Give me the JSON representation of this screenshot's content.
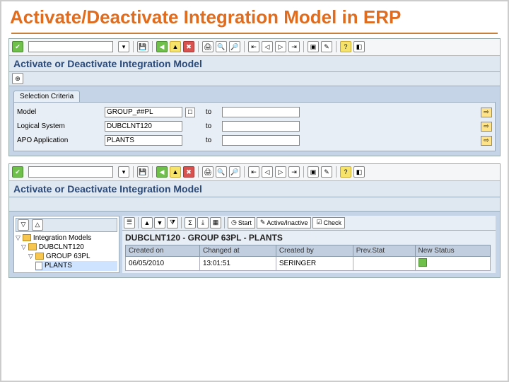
{
  "slide": {
    "title": "Activate/Deactivate Integration Model in ERP"
  },
  "win1": {
    "title": "Activate or Deactivate Integration Model",
    "tab": "Selection Criteria",
    "rows": [
      {
        "label": "Model",
        "value": "GROUP_##PL",
        "to": "to"
      },
      {
        "label": "Logical System",
        "value": "DUBCLNT120",
        "to": "to"
      },
      {
        "label": "APO Application",
        "value": "PLANTS",
        "to": "to"
      }
    ]
  },
  "win2": {
    "title": "Activate or Deactivate Integration Model",
    "tree": {
      "root": "Integration Models",
      "client": "DUBCLNT120",
      "group": "GROUP 63PL",
      "leaf": "PLANTS"
    },
    "buttons": {
      "start": "Start",
      "active": "Active/Inactive",
      "check": "Check"
    },
    "grid_title": "DUBCLNT120 - GROUP 63PL - PLANTS",
    "columns": [
      "Created on",
      "Changed at",
      "Created by",
      "Prev.Stat",
      "New Status"
    ],
    "row": {
      "created_on": "06/05/2010",
      "changed_at": "13:01:51",
      "created_by": "SERINGER"
    }
  }
}
